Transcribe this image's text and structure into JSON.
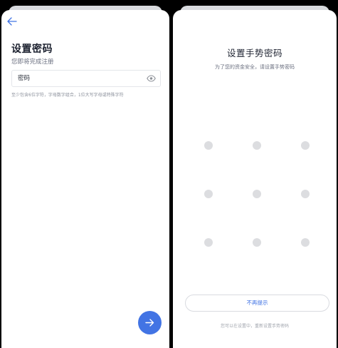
{
  "password_page": {
    "title": "设置密码",
    "subtitle": "您即将完成注册",
    "password_placeholder": "密码",
    "hint": "至少包含6位字符，字母数字组合，1位大写字母或特殊字符"
  },
  "gesture_page": {
    "title": "设置手势密码",
    "subtitle": "为了您的资金安全，请设置手势密码",
    "skip_label": "不再提示",
    "footer_note": "您可以在设置中，重新设置手势密码",
    "grid": {
      "rows": 3,
      "cols": 3
    }
  },
  "colors": {
    "accent": "#4274e4",
    "dot": "#dcdde0",
    "title_text": "#1d2230"
  },
  "icons": {
    "back": "arrow-left-icon",
    "eye": "eye-icon",
    "next": "arrow-right-icon"
  }
}
